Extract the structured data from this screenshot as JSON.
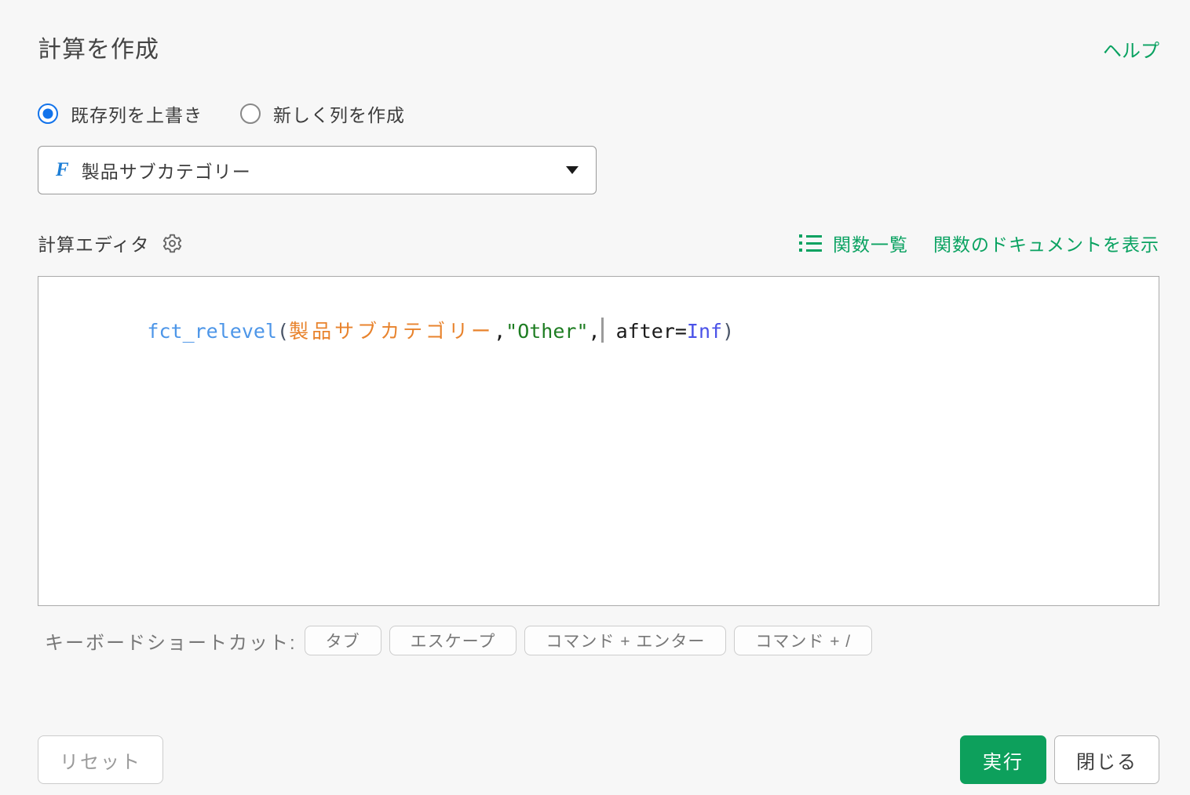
{
  "header": {
    "title": "計算を作成",
    "help_label": "ヘルプ"
  },
  "mode_radios": {
    "overwrite": {
      "label": "既存列を上書き",
      "selected": true
    },
    "new_column": {
      "label": "新しく列を作成",
      "selected": false
    }
  },
  "column_select": {
    "type_badge": "F",
    "value": "製品サブカテゴリー",
    "icon": "caret-down-icon"
  },
  "editor": {
    "label": "計算エディタ",
    "settings_icon": "gear-icon",
    "links": {
      "function_list_icon": "list-icon",
      "function_list": "関数一覧",
      "function_docs": "関数のドキュメントを表示"
    },
    "code_full": "fct_relevel(製品サブカテゴリー,\"Other\", after=Inf)",
    "code_tokens": [
      {
        "text": "fct_relevel",
        "type": "function"
      },
      {
        "text": "(",
        "type": "paren"
      },
      {
        "text": "製品サブカテゴリー",
        "type": "column"
      },
      {
        "text": ",",
        "type": "plain"
      },
      {
        "text": "\"Other\"",
        "type": "string"
      },
      {
        "text": ",",
        "type": "plain"
      },
      {
        "text": " after=",
        "type": "plain"
      },
      {
        "text": "Inf",
        "type": "atom"
      },
      {
        "text": ")",
        "type": "paren"
      }
    ]
  },
  "shortcuts": {
    "label": "キーボードショートカット:",
    "keys": [
      "タブ",
      "エスケープ",
      "コマンド + エンター",
      "コマンド + /"
    ]
  },
  "footer": {
    "reset_label": "リセット",
    "run_label": "実行",
    "close_label": "閉じる"
  },
  "colors": {
    "accent_green": "#0aa261",
    "run_button_green": "#0da05c",
    "radio_blue": "#1273eb",
    "factor_type_blue": "#1c7ed6",
    "code_function": "#4d96e8",
    "code_column": "#e8832d",
    "code_string": "#1e7d22",
    "code_atom": "#4a52e8",
    "background": "#f7f7f7"
  }
}
